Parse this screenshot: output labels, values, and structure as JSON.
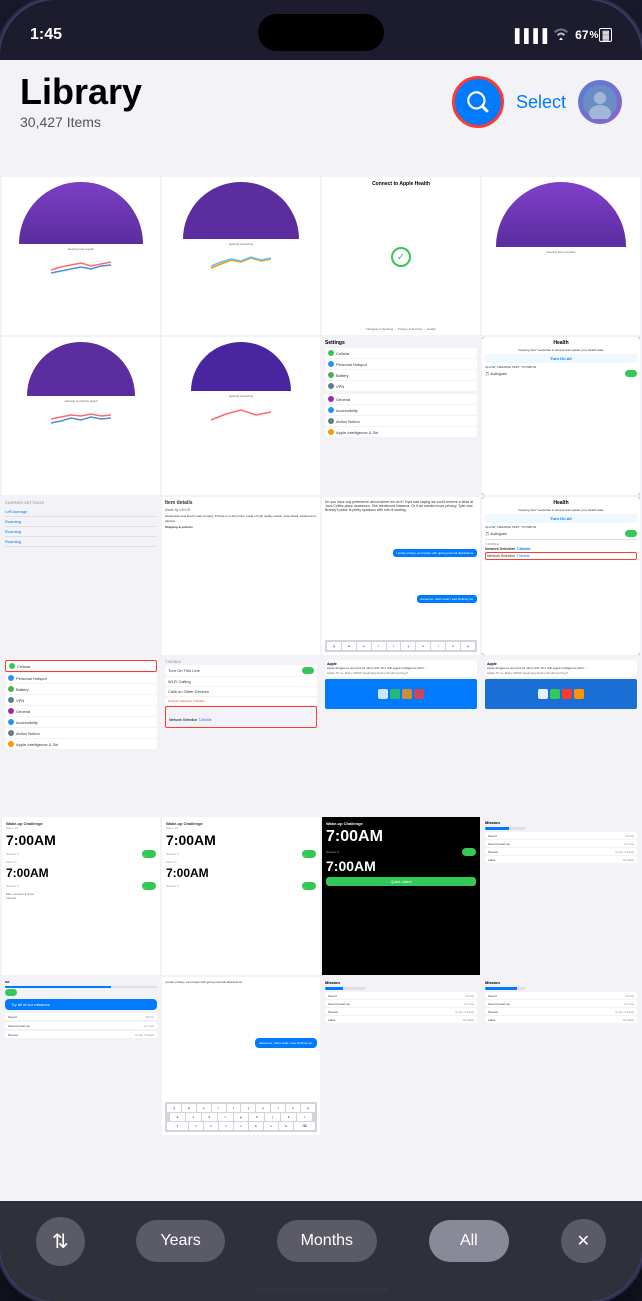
{
  "status_bar": {
    "time": "1:45",
    "battery": "67",
    "signal_bars": "4",
    "wifi": true
  },
  "header": {
    "title": "Library",
    "item_count": "30,427 Items",
    "select_label": "Select",
    "search_icon": "search-icon",
    "avatar_icon": "avatar-icon"
  },
  "toolbar": {
    "sort_label": "⇅",
    "years_label": "Years",
    "months_label": "Months",
    "all_label": "All",
    "close_label": "✕"
  },
  "grid": {
    "description": "Photo library grid with 30427 items"
  }
}
